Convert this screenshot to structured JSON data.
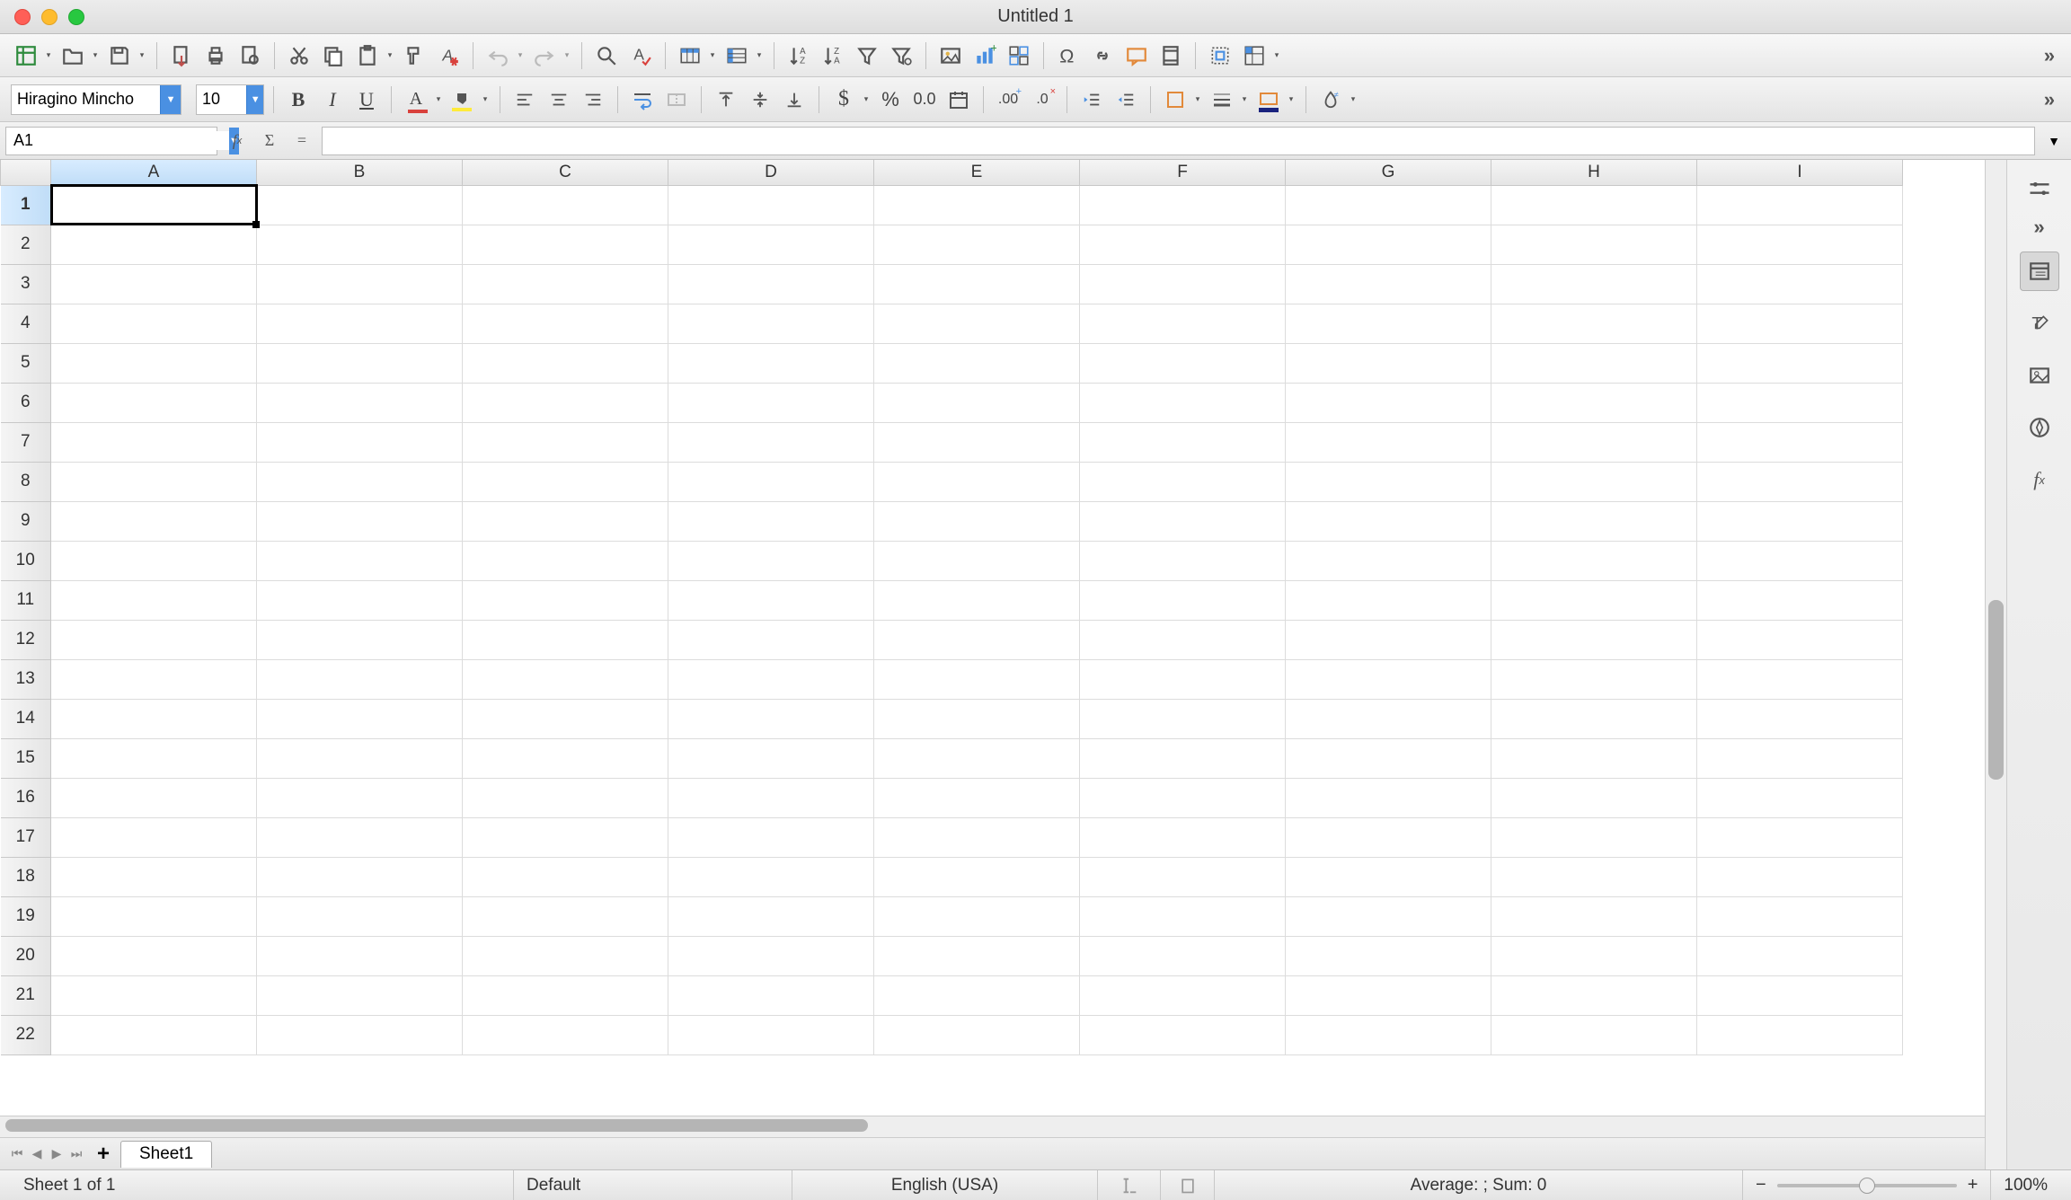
{
  "window": {
    "title": "Untitled 1"
  },
  "toolbar": {
    "font_name": "Hiragino Mincho",
    "font_size": "10"
  },
  "namebox": {
    "ref": "A1"
  },
  "formula": {
    "value": ""
  },
  "columns": [
    "A",
    "B",
    "C",
    "D",
    "E",
    "F",
    "G",
    "H",
    "I"
  ],
  "rows": [
    "1",
    "2",
    "3",
    "4",
    "5",
    "6",
    "7",
    "8",
    "9",
    "10",
    "11",
    "12",
    "13",
    "14",
    "15",
    "16",
    "17",
    "18",
    "19",
    "20",
    "21",
    "22"
  ],
  "selected": {
    "col": "A",
    "row": "1"
  },
  "tabs": {
    "sheet1": "Sheet1"
  },
  "status": {
    "sheet_count": "Sheet 1 of 1",
    "style": "Default",
    "language": "English (USA)",
    "summary": "Average: ; Sum: 0",
    "zoom": "100%"
  }
}
